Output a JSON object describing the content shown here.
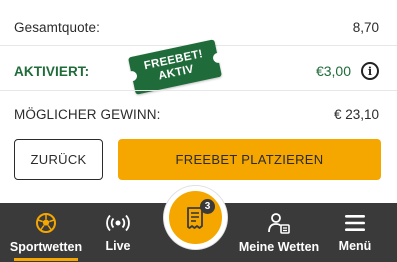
{
  "summary": {
    "total_odds_label": "Gesamtquote:",
    "total_odds_value": "8,70",
    "activated_label": "AKTIVIERT:",
    "activated_value": "€3,00",
    "stamp_line1": "FREEBET!",
    "stamp_line2": "AKTIV",
    "possible_win_label": "MÖGLICHER GEWINN:",
    "possible_win_value": "€ 23,10"
  },
  "actions": {
    "back_label": "ZURÜCK",
    "place_label": "FREEBET PLATZIEREN"
  },
  "nav": {
    "items": [
      {
        "label": "Sportwetten",
        "icon": "soccer-ball-icon",
        "active": true
      },
      {
        "label": "Live",
        "icon": "live-broadcast-icon",
        "active": false
      },
      {
        "label": "Meine Wetten",
        "icon": "user-bets-icon",
        "active": false
      },
      {
        "label": "Menü",
        "icon": "hamburger-menu-icon",
        "active": false
      }
    ],
    "betslip": {
      "icon": "betslip-icon",
      "count": "3"
    }
  },
  "colors": {
    "accent": "#f5a700",
    "green": "#1f6b3a",
    "nav_bg": "#3a3a3a"
  }
}
